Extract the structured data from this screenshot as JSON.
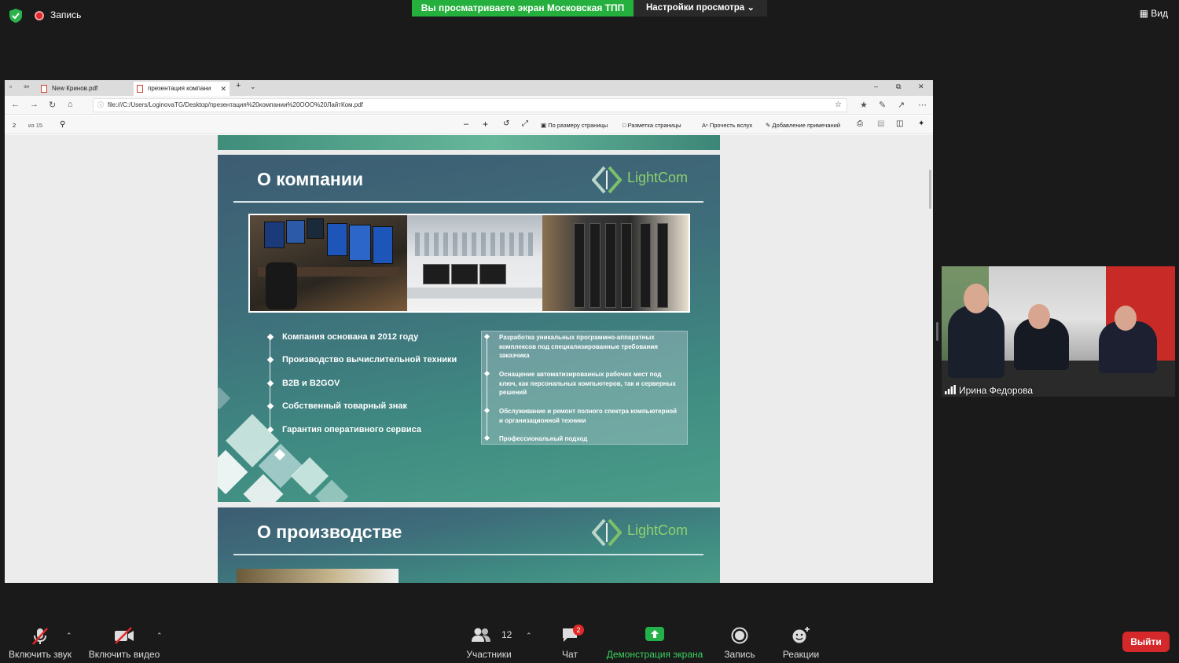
{
  "top_bar": {
    "recording_label": "Запись",
    "share_banner": "Вы просматриваете экран Московская ТПП",
    "view_settings": "Настройки просмотра",
    "view_button": "Вид"
  },
  "browser": {
    "tabs": [
      {
        "label": "New Кринов.pdf"
      },
      {
        "label": "презентация компани"
      }
    ],
    "url": "file:///C:/Users/LoginovaTG/Desktop/презентация%20компании%20ООО%20ЛайтКом.pdf",
    "pdf_toolbar": {
      "page_current": "2",
      "page_total": "из 15",
      "fit_page": "По размеру страницы",
      "page_layout": "Разметка страницы",
      "read_aloud": "Прочесть вслух",
      "add_notes": "Добавление примечаний"
    }
  },
  "slide1": {
    "title": "О компании",
    "logo": "LightCom",
    "bullets": [
      "Компания основана в 2012 году",
      "Производство вычислительной техники",
      "B2B и B2GOV",
      "Собственный товарный знак",
      "Гарантия оперативного сервиса"
    ],
    "panel_items": [
      "Разработка уникальных программно-аппаратных комплексов под специализированные требования заказчика",
      "Оснащение автоматизированных рабочих мест под ключ, как персональных компьютеров, так и серверных решений",
      "Обслуживание и ремонт полного спектра компьютерной и организационной техники",
      "Профессиональный подход"
    ]
  },
  "slide2": {
    "title": "О производстве",
    "logo": "LightCom"
  },
  "video": {
    "participant_name": "Ирина Федорова"
  },
  "toolbar": {
    "unmute": "Включить звук",
    "start_video": "Включить видео",
    "participants": "Участники",
    "participants_count": "12",
    "chat": "Чат",
    "chat_badge": "2",
    "share_screen": "Демонстрация экрана",
    "record": "Запись",
    "reactions": "Реакции",
    "leave": "Выйти"
  }
}
